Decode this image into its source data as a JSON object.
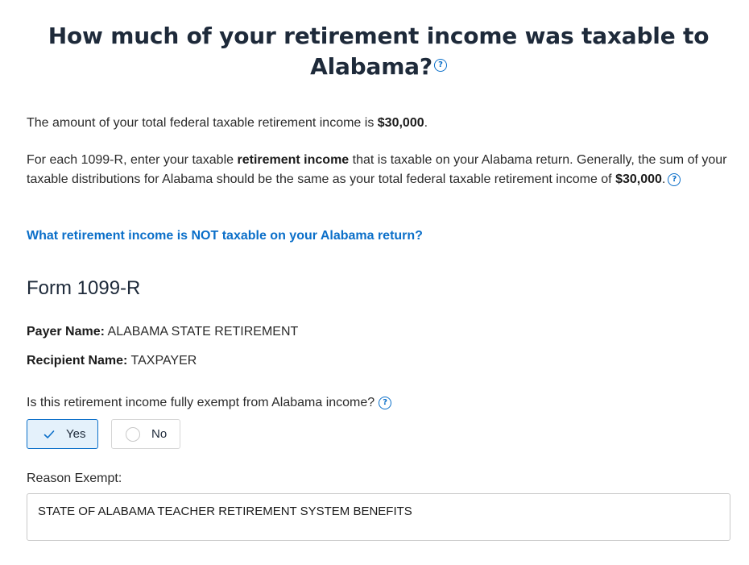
{
  "page": {
    "title": "How much of your retirement income was taxable to Alabama?",
    "help_glyph": "?"
  },
  "intro": {
    "total_prefix": "The amount of your total federal taxable retirement income is ",
    "total_amount": "$30,000",
    "total_suffix": ".",
    "instr_part1": "For each 1099-R, enter your taxable ",
    "instr_bold": "retirement income",
    "instr_part2": " that is taxable on your Alabama return. Generally, the sum of your taxable distributions for Alabama should be the same as your total federal taxable retirement income of ",
    "instr_amount": "$30,000",
    "instr_suffix": "."
  },
  "link": {
    "text": "What retirement income is NOT taxable on your Alabama return?"
  },
  "form": {
    "title": "Form 1099-R",
    "payer_label": "Payer Name:",
    "payer_value": " ALABAMA STATE RETIREMENT",
    "recipient_label": "Recipient Name:",
    "recipient_value": " TAXPAYER",
    "exempt_question": "Is this retirement income fully exempt from Alabama income?",
    "yes_label": "Yes",
    "no_label": "No",
    "selected": "Yes",
    "reason_label": "Reason Exempt:",
    "reason_value": "STATE OF ALABAMA TEACHER RETIREMENT SYSTEM BENEFITS"
  },
  "colors": {
    "accent": "#0b6fc9",
    "selected_bg": "#e4f1fb",
    "heading": "#1e2a3a"
  },
  "icons": {
    "help": "help-circle-icon",
    "check": "checkmark-icon",
    "radio": "radio-empty-icon"
  }
}
